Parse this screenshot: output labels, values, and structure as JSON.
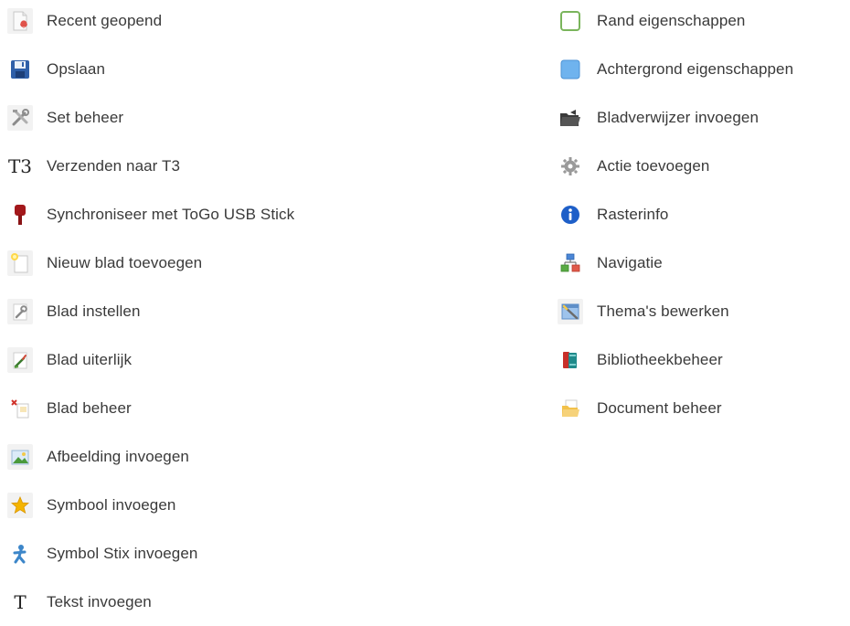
{
  "left_items": [
    {
      "label": "Recent geopend",
      "icon": "recent-document-icon"
    },
    {
      "label": "Opslaan",
      "icon": "save-disk-icon"
    },
    {
      "label": "Set beheer",
      "icon": "tools-icon"
    },
    {
      "label": "Verzenden naar T3",
      "icon": "t3-icon",
      "glyph": "T3"
    },
    {
      "label": "Synchroniseer met ToGo USB Stick",
      "icon": "usb-stick-icon"
    },
    {
      "label": "Nieuw blad toevoegen",
      "icon": "new-page-icon"
    },
    {
      "label": "Blad instellen",
      "icon": "wrench-page-icon"
    },
    {
      "label": "Blad uiterlijk",
      "icon": "brush-page-icon"
    },
    {
      "label": "Blad beheer",
      "icon": "page-manage-icon"
    },
    {
      "label": "Afbeelding invoegen",
      "icon": "image-icon"
    },
    {
      "label": "Symbool invoegen",
      "icon": "star-icon"
    },
    {
      "label": "Symbol Stix invoegen",
      "icon": "stix-figure-icon"
    },
    {
      "label": "Tekst invoegen",
      "icon": "text-t-icon",
      "glyph": "T"
    }
  ],
  "right_items": [
    {
      "label": "Rand eigenschappen",
      "icon": "border-square-icon"
    },
    {
      "label": "Achtergrond eigenschappen",
      "icon": "background-square-icon"
    },
    {
      "label": "Bladverwijzer invoegen",
      "icon": "folder-link-icon"
    },
    {
      "label": "Actie toevoegen",
      "icon": "gear-icon"
    },
    {
      "label": "Rasterinfo",
      "icon": "info-icon"
    },
    {
      "label": "Navigatie",
      "icon": "navigation-tree-icon"
    },
    {
      "label": "Thema's bewerken",
      "icon": "theme-edit-icon"
    },
    {
      "label": "Bibliotheekbeheer",
      "icon": "library-books-icon"
    },
    {
      "label": "Document beheer",
      "icon": "document-folder-icon"
    }
  ],
  "colors": {
    "text": "#3a3a3a",
    "icon_bg": "#f2f2f2",
    "save_blue": "#2f5fa8",
    "usb_red": "#a3181b",
    "border_green": "#7ab55c",
    "bg_blue": "#6fb3ee",
    "info_blue": "#1e5fc8",
    "star_yellow": "#f4b400"
  }
}
